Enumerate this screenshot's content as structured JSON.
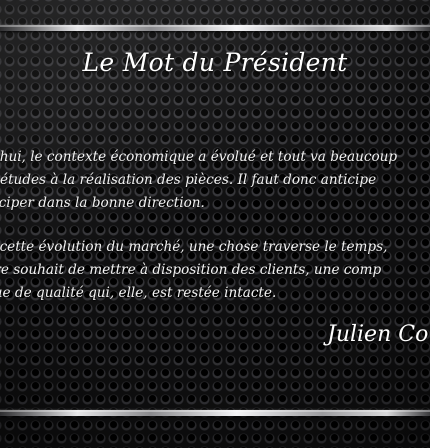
{
  "title": "Le Mot du Président",
  "paragraphs": [
    {
      "lines": [
        "urd'hui, le contexte économique a évolué et tout va beaucoup",
        "des études à la réalisation des pièces. Il faut donc anticipe",
        "anticiper dans la bonne direction."
      ]
    },
    {
      "lines": [
        "gré cette évolution du marché, une chose traverse le  temps,",
        "notre souhait de mettre à disposition des clients, une comp",
        "nique de qualité qui, elle, est restée intacte."
      ]
    }
  ],
  "signature": "Julien Co"
}
